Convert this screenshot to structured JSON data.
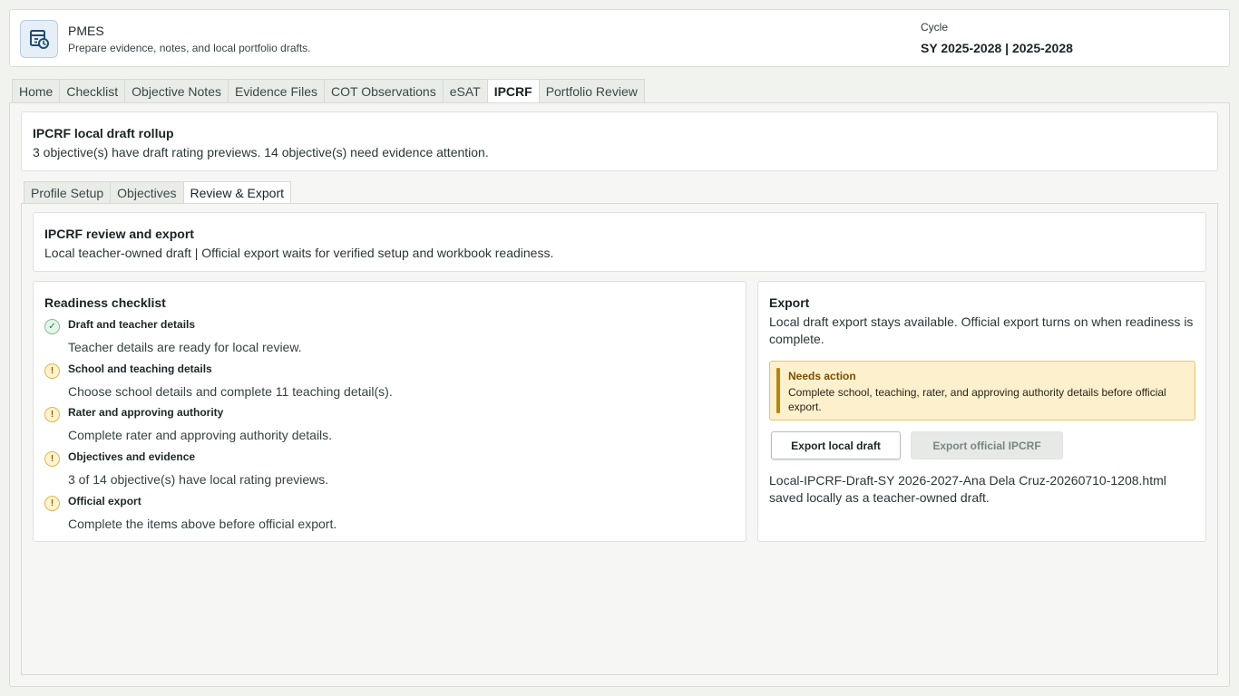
{
  "header": {
    "app_name": "PMES",
    "subtitle": "Prepare evidence, notes, and local portfolio drafts.",
    "cycle_label": "Cycle",
    "cycle_value": "SY 2025-2028 | 2025-2028",
    "logo_icon": "calendar-clock-icon"
  },
  "main_tabs": [
    {
      "label": "Home",
      "active": false
    },
    {
      "label": "Checklist",
      "active": false
    },
    {
      "label": "Objective Notes",
      "active": false
    },
    {
      "label": "Evidence Files",
      "active": false
    },
    {
      "label": "COT Observations",
      "active": false
    },
    {
      "label": "eSAT",
      "active": false
    },
    {
      "label": "IPCRF",
      "active": true
    },
    {
      "label": "Portfolio Review",
      "active": false
    }
  ],
  "rollup": {
    "title": "IPCRF local draft rollup",
    "text": "3 objective(s) have draft rating previews. 14 objective(s) need evidence attention."
  },
  "sub_tabs": [
    {
      "label": "Profile Setup",
      "active": false
    },
    {
      "label": "Objectives",
      "active": false
    },
    {
      "label": "Review & Export",
      "active": true
    }
  ],
  "review": {
    "title": "IPCRF review and export",
    "text": "Local teacher-owned draft | Official export waits for verified setup and workbook readiness."
  },
  "readiness": {
    "title": "Readiness checklist",
    "items": [
      {
        "title": "Draft and teacher details",
        "desc": "Teacher details are ready for local review.",
        "status": "ok",
        "icon": "check-icon"
      },
      {
        "title": "School and teaching details",
        "desc": "Choose school details and complete 11 teaching detail(s).",
        "status": "warn",
        "icon": "exclamation-icon"
      },
      {
        "title": "Rater and approving authority",
        "desc": "Complete rater and approving authority details.",
        "status": "warn",
        "icon": "exclamation-icon"
      },
      {
        "title": "Objectives and evidence",
        "desc": "3 of 14 objective(s) have local rating previews.",
        "status": "warn",
        "icon": "exclamation-icon"
      },
      {
        "title": "Official export",
        "desc": "Complete the items above before official export.",
        "status": "warn",
        "icon": "exclamation-icon"
      }
    ]
  },
  "export": {
    "title": "Export",
    "text": "Local draft export stays available. Official export turns on when readiness is complete.",
    "alert_title": "Needs action",
    "alert_text": "Complete school, teaching, rater, and approving authority details before official export.",
    "local_button": "Export local draft",
    "official_button": "Export official IPCRF",
    "saved_text": "Local-IPCRF-Draft-SY 2026-2027-Ana Dela Cruz-20260710-1208.html saved locally as a teacher-owned draft."
  },
  "colors": {
    "background": "#f1f3ef",
    "ok": "#1f7a3e",
    "warn": "#8a5d00",
    "alert_bg": "#fdf0cc",
    "alert_bar": "#b78410"
  }
}
